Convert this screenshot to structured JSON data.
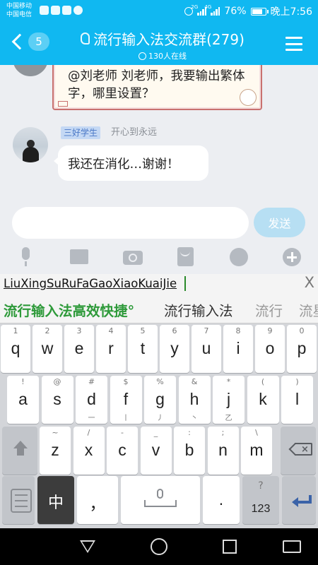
{
  "status_bar": {
    "carrier_1": "中国移动",
    "carrier_2": "中国电信",
    "battery": "76%",
    "time": "晚上7:56",
    "network_label": "4G",
    "second_network_label": "2G"
  },
  "header": {
    "unread_count": "5",
    "title": "流行输入法交流群(279)",
    "subtitle": "130人在线",
    "background_color": "#10b8f1"
  },
  "chat": {
    "previous_message": {
      "text": "@刘老师 刘老师，我要输出繁体字，哪里设置？"
    },
    "message": {
      "badge": "三好学生",
      "nickname": "开心到永远",
      "text": "我还在消化…谢谢！"
    }
  },
  "composer": {
    "input_value": "",
    "send_label": "发送",
    "tools": [
      "mic-icon",
      "image-icon",
      "camera-icon",
      "red-packet-icon",
      "emoji-icon",
      "plus-icon"
    ]
  },
  "ime": {
    "pinyin": "LiuXingSuRuFaGaoXiaoKuaiJie",
    "close_label": "X",
    "candidates": [
      "流行输入法高效快捷°",
      "流行输入法",
      "流行",
      "流星"
    ],
    "row1": [
      {
        "hint": "1",
        "key": "q"
      },
      {
        "hint": "2",
        "key": "w"
      },
      {
        "hint": "3",
        "key": "e"
      },
      {
        "hint": "4",
        "key": "r"
      },
      {
        "hint": "5",
        "key": "t"
      },
      {
        "hint": "6",
        "key": "y"
      },
      {
        "hint": "7",
        "key": "u"
      },
      {
        "hint": "8",
        "key": "i"
      },
      {
        "hint": "9",
        "key": "o"
      },
      {
        "hint": "0",
        "key": "p"
      }
    ],
    "row2": [
      {
        "hint": "!",
        "key": "a",
        "sub": ""
      },
      {
        "hint": "@",
        "key": "s",
        "sub": ""
      },
      {
        "hint": "#",
        "key": "d",
        "sub": "一"
      },
      {
        "hint": "$",
        "key": "f",
        "sub": "丨"
      },
      {
        "hint": "%",
        "key": "g",
        "sub": "丿"
      },
      {
        "hint": "&",
        "key": "h",
        "sub": "丶"
      },
      {
        "hint": "*",
        "key": "j",
        "sub": "乙"
      },
      {
        "hint": "(",
        "key": "k",
        "sub": ""
      },
      {
        "hint": ")",
        "key": "l",
        "sub": ""
      }
    ],
    "row3": [
      {
        "hint": "~",
        "key": "z"
      },
      {
        "hint": "/",
        "key": "x"
      },
      {
        "hint": "-",
        "key": "c"
      },
      {
        "hint": "_",
        "key": "v"
      },
      {
        "hint": ":",
        "key": "b"
      },
      {
        "hint": ";",
        "key": "n"
      },
      {
        "hint": "\\",
        "key": "m"
      }
    ],
    "row4": {
      "lang_key": "中",
      "comma_key": "，",
      "period_key": ".",
      "num_hint": "?",
      "num_key": "123"
    }
  }
}
